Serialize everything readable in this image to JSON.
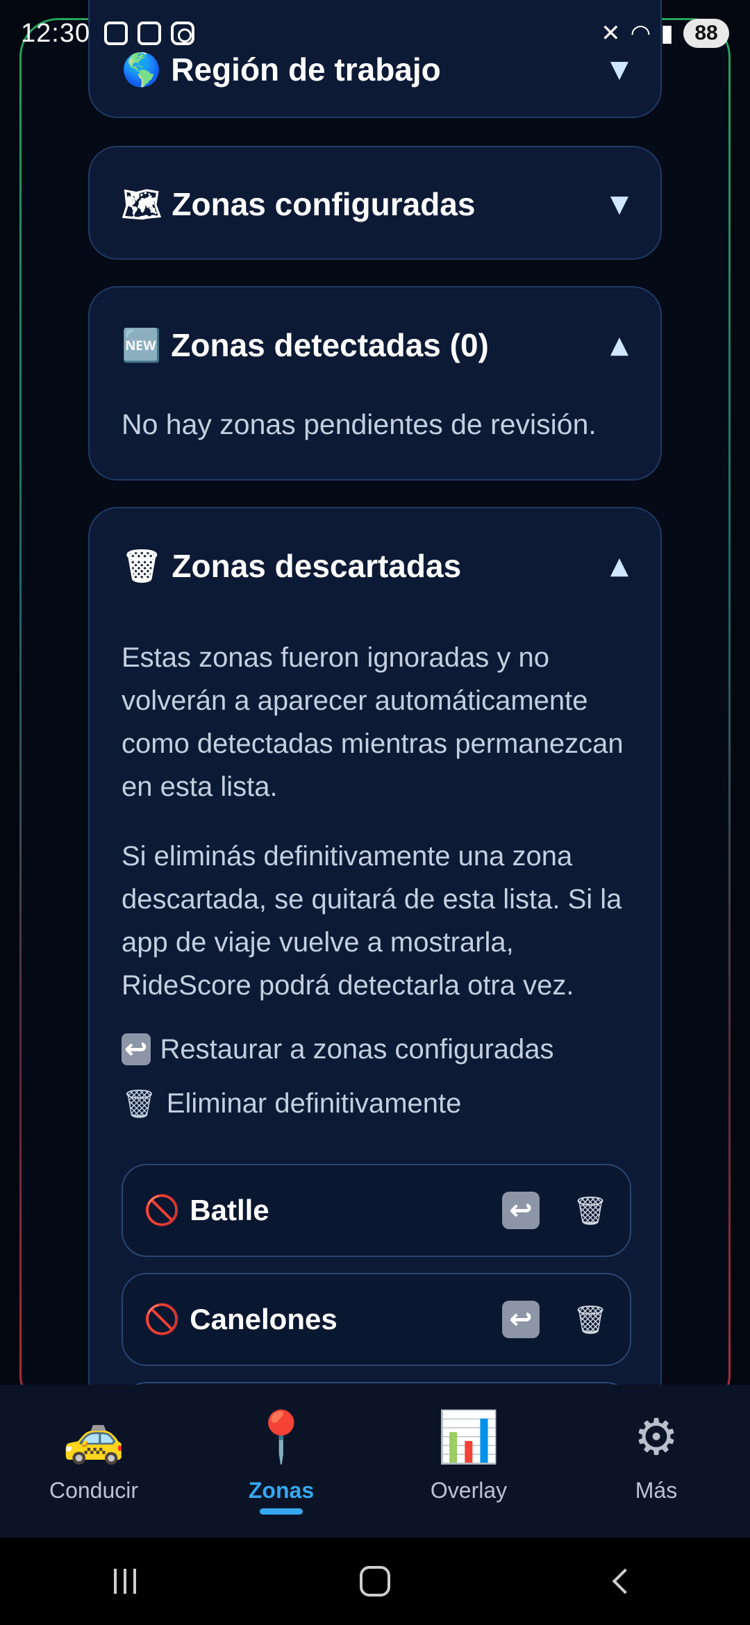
{
  "status_bar": {
    "time": "12:30",
    "battery": "88",
    "left_icons": [
      "screenshot-icon",
      "notification-icon",
      "instagram-icon"
    ],
    "right_icons": [
      "mute-icon",
      "wifi-icon",
      "signal-icon"
    ]
  },
  "sections": {
    "region": {
      "emoji": "🌎",
      "title": "Región de trabajo",
      "chevron": "▼"
    },
    "configured": {
      "emoji": "🗺",
      "title": "Zonas configuradas",
      "chevron": "▼"
    },
    "detected": {
      "emoji": "🆕",
      "title": "Zonas detectadas (0)",
      "chevron": "▲",
      "empty_text": "No hay zonas pendientes de revisión."
    },
    "discarded": {
      "emoji": "🗑",
      "title": "Zonas descartadas",
      "chevron": "▲",
      "paragraph1": "Estas zonas fueron ignoradas y no volverán a aparecer automáticamente como detectadas mientras permanezcan en esta lista.",
      "paragraph2": "Si eliminás definitivamente una zona descartada, se quitará de esta lista. Si la app de viaje vuelve a mostrarla, RideScore podrá detectarla otra vez.",
      "legend_restore_icon": "↩",
      "legend_restore": "Restaurar a zonas configuradas",
      "legend_delete_icon": "🗑",
      "legend_delete": "Eliminar definitivamente",
      "items": [
        {
          "icon": "🚫",
          "name": "Batlle",
          "restore_icon": "↩",
          "delete_icon": "🗑"
        },
        {
          "icon": "🚫",
          "name": "Canelones",
          "restore_icon": "↩",
          "delete_icon": "🗑"
        }
      ]
    }
  },
  "bottom_nav": [
    {
      "icon": "🚕",
      "label": "Conducir",
      "active": false
    },
    {
      "icon": "📍",
      "label": "Zonas",
      "active": true
    },
    {
      "icon": "📊",
      "label": "Overlay",
      "active": false
    },
    {
      "icon": "⚙",
      "label": "Más",
      "active": false
    }
  ],
  "colors": {
    "background": "#030710",
    "card": "#0c1a35",
    "card_border": "#1f3a63",
    "accent": "#35a8f0",
    "ban": "#e23b46"
  }
}
